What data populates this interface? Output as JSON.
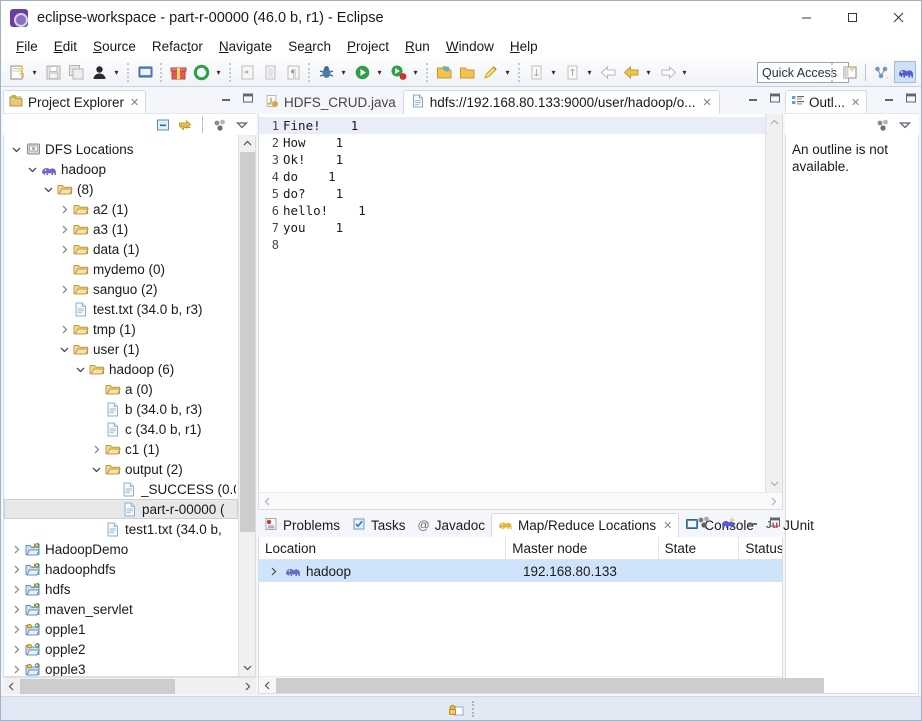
{
  "window": {
    "title": "eclipse-workspace - part-r-00000 (46.0 b, r1) - Eclipse",
    "app_icon": "eclipse-icon",
    "minimize": "—",
    "maximize": "□",
    "close": "✕"
  },
  "menubar": {
    "items": [
      {
        "label": "File",
        "mnemonic": "F"
      },
      {
        "label": "Edit",
        "mnemonic": "E"
      },
      {
        "label": "Source",
        "mnemonic": "S"
      },
      {
        "label": "Refactor",
        "mnemonic": "t"
      },
      {
        "label": "Navigate",
        "mnemonic": "N"
      },
      {
        "label": "Search",
        "mnemonic": "a"
      },
      {
        "label": "Project",
        "mnemonic": "P"
      },
      {
        "label": "Run",
        "mnemonic": "R"
      },
      {
        "label": "Window",
        "mnemonic": "W"
      },
      {
        "label": "Help",
        "mnemonic": "H"
      }
    ]
  },
  "toolbar": {
    "quick_access_placeholder": "Quick Access",
    "icons": [
      "new-wizard-icon",
      "save-icon",
      "save-all-icon",
      "user-icon",
      "new-window-icon",
      "gift-icon",
      "refresh-icon",
      "export-icon",
      "book-icon",
      "paragraph-icon",
      "debug-icon",
      "run-icon",
      "run-coverage-icon",
      "open-folder-icon",
      "open-type-icon",
      "pencil-icon",
      "next-annotation-icon",
      "previous-annotation-icon",
      "back-icon",
      "forward-icon",
      "forward-arrow-icon"
    ],
    "perspective": [
      "open-perspective-icon",
      "java-perspective-icon",
      "mapreduce-perspective-icon"
    ]
  },
  "project_explorer": {
    "tab_label": "Project Explorer",
    "tab_icon": "project-explorer-icon",
    "close_icon": "close-icon",
    "minimize_icon": "minimize-icon",
    "maximize_icon": "maximize-icon",
    "toolbar_icons": [
      "collapse-all-icon",
      "link-with-editor-icon",
      "view-menu-filter-icon",
      "view-menu-icon"
    ],
    "tree": [
      {
        "indent": 0,
        "twisty": "down",
        "icon": "dfs-locations-icon",
        "label": "DFS Locations",
        "selected": false
      },
      {
        "indent": 1,
        "twisty": "down",
        "icon": "hadoop-elephant-icon",
        "label": "hadoop",
        "selected": false
      },
      {
        "indent": 2,
        "twisty": "down",
        "icon": "folder-icon",
        "label": "(8)",
        "selected": false
      },
      {
        "indent": 3,
        "twisty": "right",
        "icon": "folder-icon",
        "label": "a2 (1)",
        "selected": false
      },
      {
        "indent": 3,
        "twisty": "right",
        "icon": "folder-icon",
        "label": "a3 (1)",
        "selected": false
      },
      {
        "indent": 3,
        "twisty": "right",
        "icon": "folder-icon",
        "label": "data (1)",
        "selected": false
      },
      {
        "indent": 3,
        "twisty": "none",
        "icon": "folder-icon",
        "label": "mydemo (0)",
        "selected": false
      },
      {
        "indent": 3,
        "twisty": "right",
        "icon": "folder-icon",
        "label": "sanguo (2)",
        "selected": false
      },
      {
        "indent": 3,
        "twisty": "none",
        "icon": "file-icon",
        "label": "test.txt (34.0 b, r3)",
        "selected": false
      },
      {
        "indent": 3,
        "twisty": "right",
        "icon": "folder-icon",
        "label": "tmp (1)",
        "selected": false
      },
      {
        "indent": 3,
        "twisty": "down",
        "icon": "folder-icon",
        "label": "user (1)",
        "selected": false
      },
      {
        "indent": 4,
        "twisty": "down",
        "icon": "folder-icon",
        "label": "hadoop (6)",
        "selected": false
      },
      {
        "indent": 5,
        "twisty": "none",
        "icon": "folder-icon",
        "label": "a (0)",
        "selected": false
      },
      {
        "indent": 5,
        "twisty": "none",
        "icon": "file-icon",
        "label": "b (34.0 b, r3)",
        "selected": false
      },
      {
        "indent": 5,
        "twisty": "none",
        "icon": "file-icon",
        "label": "c (34.0 b, r1)",
        "selected": false
      },
      {
        "indent": 5,
        "twisty": "right",
        "icon": "folder-icon",
        "label": "c1 (1)",
        "selected": false
      },
      {
        "indent": 5,
        "twisty": "down",
        "icon": "folder-icon",
        "label": "output (2)",
        "selected": false
      },
      {
        "indent": 6,
        "twisty": "none",
        "icon": "file-icon",
        "label": "_SUCCESS (0.0",
        "selected": false
      },
      {
        "indent": 6,
        "twisty": "none",
        "icon": "file-icon",
        "label": "part-r-00000 (",
        "selected": true
      },
      {
        "indent": 5,
        "twisty": "none",
        "icon": "file-icon",
        "label": "test1.txt (34.0 b,",
        "selected": false
      },
      {
        "indent": 0,
        "twisty": "right",
        "icon": "java-project-icon",
        "label": "HadoopDemo",
        "selected": false
      },
      {
        "indent": 0,
        "twisty": "right",
        "icon": "java-project-icon",
        "label": "hadoophdfs",
        "selected": false
      },
      {
        "indent": 0,
        "twisty": "right",
        "icon": "java-project-icon",
        "label": "hdfs",
        "selected": false
      },
      {
        "indent": 0,
        "twisty": "right",
        "icon": "java-project-icon",
        "label": "maven_servlet",
        "selected": false
      },
      {
        "indent": 0,
        "twisty": "right",
        "icon": "maven-project-icon",
        "label": "opple1",
        "selected": false
      },
      {
        "indent": 0,
        "twisty": "right",
        "icon": "maven-project-icon",
        "label": "opple2",
        "selected": false
      },
      {
        "indent": 0,
        "twisty": "right",
        "icon": "maven-project-icon",
        "label": "opple3",
        "selected": false
      },
      {
        "indent": 0,
        "twisty": "right",
        "icon": "maven-project-icon",
        "label": "project00",
        "selected": false
      }
    ]
  },
  "editor": {
    "tabs": [
      {
        "label": "HDFS_CRUD.java",
        "icon": "java-file-icon",
        "active": false,
        "closable": false
      },
      {
        "label": "hdfs://192.168.80.133:9000/user/hadoop/o...",
        "icon": "text-file-icon",
        "active": true,
        "closable": true
      }
    ],
    "minimize_icon": "minimize-icon",
    "maximize_icon": "maximize-icon",
    "lines": [
      {
        "no": "1",
        "text": "Fine!\t1",
        "current": true
      },
      {
        "no": "2",
        "text": "How\t1",
        "current": false
      },
      {
        "no": "3",
        "text": "Ok!\t1",
        "current": false
      },
      {
        "no": "4",
        "text": "do\t1",
        "current": false
      },
      {
        "no": "5",
        "text": "do?\t1",
        "current": false
      },
      {
        "no": "6",
        "text": "hello!\t1",
        "current": false
      },
      {
        "no": "7",
        "text": "you\t1",
        "current": false
      },
      {
        "no": "8",
        "text": "",
        "current": false
      }
    ]
  },
  "outline": {
    "tab_label": "Outl...",
    "tab_icon": "outline-icon",
    "close_icon": "close-icon",
    "toolbar_icons": [
      "view-menu-filter-icon",
      "view-menu-icon"
    ],
    "message": "An outline is not available."
  },
  "bottom_panel": {
    "tabs": [
      {
        "label": "Problems",
        "icon": "problems-icon",
        "active": false,
        "closable": false
      },
      {
        "label": "Tasks",
        "icon": "tasks-icon",
        "active": false,
        "closable": false
      },
      {
        "label": "Javadoc",
        "icon": "javadoc-icon",
        "active": false,
        "closable": false
      },
      {
        "label": "Map/Reduce Locations",
        "icon": "mapreduce-icon",
        "active": true,
        "closable": true
      },
      {
        "label": "Console",
        "icon": "console-icon",
        "active": false,
        "closable": false
      },
      {
        "label": "JUnit",
        "icon": "junit-icon",
        "active": false,
        "closable": false
      }
    ],
    "toolbar_icons": [
      "new-location-icon",
      "edit-location-icon"
    ],
    "minimize_icon": "minimize-icon",
    "maximize_icon": "maximize-icon",
    "table": {
      "columns": [
        "Location",
        "Master node",
        "State",
        "Status"
      ],
      "rows": [
        {
          "twisty": "right",
          "icon": "hadoop-elephant-icon",
          "location": "hadoop",
          "master_node": "192.168.80.133",
          "state": "",
          "status": "",
          "selected": true
        }
      ]
    }
  },
  "statusbar": {
    "icon": "lock-write-icon"
  },
  "colors": {
    "accent_blue": "#cfe4fb",
    "selection_gray": "#e8e8e8",
    "editor_current_line": "#e8edf7",
    "folder_yellow": "#e9b84a",
    "elephant_purple": "#6a6ac8",
    "statusbar_bg": "#e2e8f4"
  }
}
